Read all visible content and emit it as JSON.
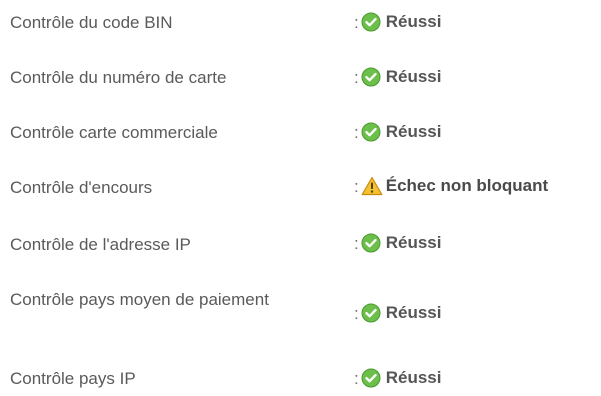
{
  "separator": ":",
  "colors": {
    "success_icon": "#6dbf4b",
    "warning_icon": "#f2c230",
    "label_text": "#5a5a5a",
    "status_text": "#555555"
  },
  "rows": [
    {
      "label": "Contrôle du code BIN",
      "status": "Réussi",
      "icon": "check-circle-icon"
    },
    {
      "label": "Contrôle du numéro de carte",
      "status": "Réussi",
      "icon": "check-circle-icon"
    },
    {
      "label": "Contrôle carte commerciale",
      "status": "Réussi",
      "icon": "check-circle-icon"
    },
    {
      "label": "Contrôle d'encours",
      "status": "Échec non bloquant",
      "icon": "warning-triangle-icon"
    },
    {
      "label": "Contrôle de l'adresse IP",
      "status": "Réussi",
      "icon": "check-circle-icon"
    },
    {
      "label": "Contrôle pays moyen de paiement",
      "status": "Réussi",
      "icon": "check-circle-icon"
    },
    {
      "label": "Contrôle pays IP",
      "status": "Réussi",
      "icon": "check-circle-icon"
    }
  ]
}
